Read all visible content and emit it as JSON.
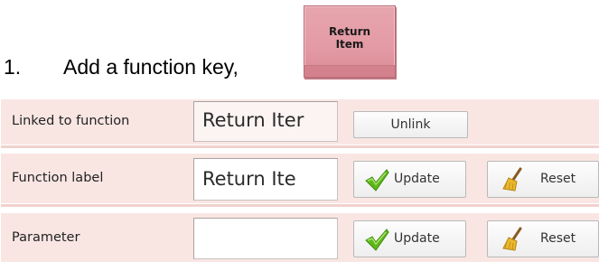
{
  "instruction": {
    "number": "1.",
    "text": "Add a function key,"
  },
  "function_key": {
    "label_line1": "Return",
    "label_line2": "Item",
    "color": "#e39aa4"
  },
  "rows": {
    "linked": {
      "label": "Linked to function",
      "value": "Return Iter",
      "button_label": "Unlink"
    },
    "function_label": {
      "label": "Function label",
      "value": "Return Ite",
      "update_label": "Update",
      "reset_label": "Reset"
    },
    "parameter": {
      "label": "Parameter",
      "value": "",
      "update_label": "Update",
      "reset_label": "Reset"
    }
  },
  "icons": {
    "update": "green-checkmark-icon",
    "reset": "broom-icon"
  },
  "colors": {
    "row_background": "#f9e6e3",
    "checkmark": "#5fb81a",
    "broom": "#e8b82c"
  }
}
